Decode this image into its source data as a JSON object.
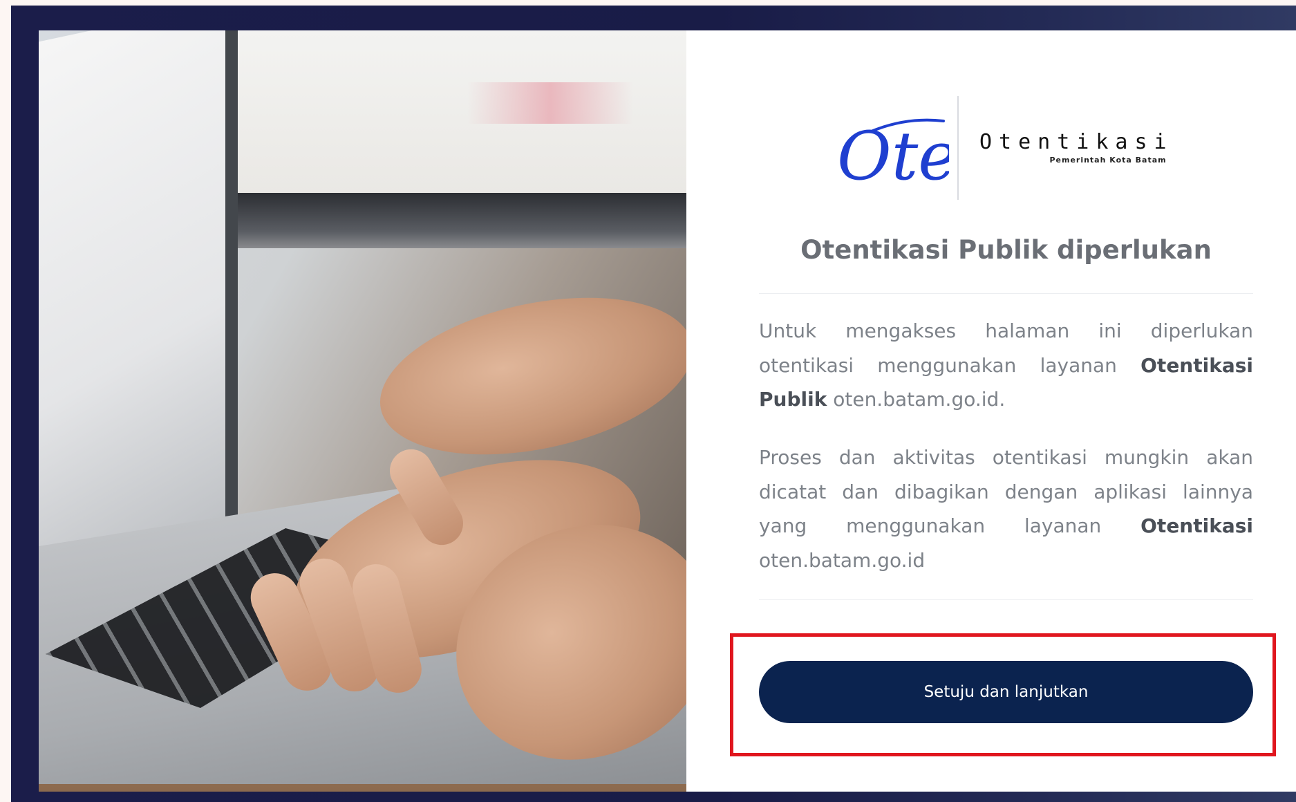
{
  "logo": {
    "mark_text": "Oten",
    "title": "Otentikasi",
    "subtitle": "Pemerintah Kota Batam"
  },
  "heading": "Otentikasi Publik diperlukan",
  "paragraph1": {
    "text_a": "Untuk mengakses halaman ini diperlukan otentikasi menggunakan layanan ",
    "bold_a": "Otentikasi Publik",
    "text_b": " oten.batam.go.id."
  },
  "paragraph2": {
    "text_a": "Proses dan aktivitas otentikasi mungkin akan dicatat dan dibagikan dengan aplikasi lainnya yang menggunakan layanan ",
    "bold_a": "Otentikasi",
    "text_b": " oten.batam.go.id"
  },
  "button": {
    "label": "Setuju dan lanjutkan"
  },
  "colors": {
    "button_bg": "#0b234f",
    "highlight_border": "#e0161e",
    "logo_blue": "#1f3fd0",
    "frame_bg": "#1b1d4a"
  },
  "photo": {
    "icon": "laptop-typing-photo"
  }
}
